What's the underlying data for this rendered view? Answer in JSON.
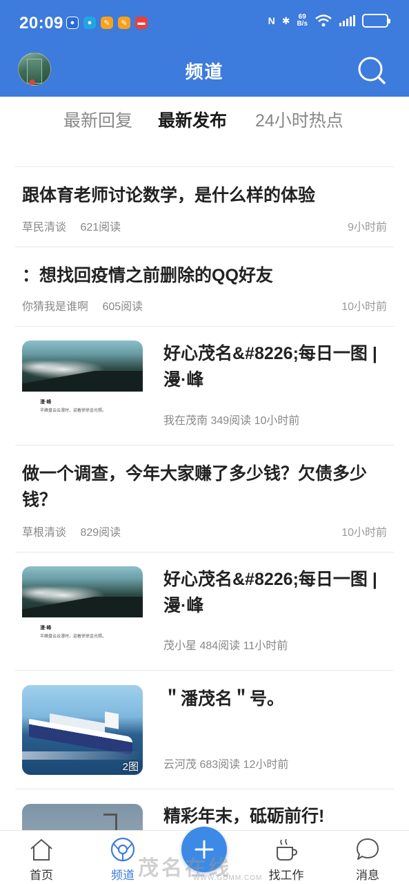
{
  "status_bar": {
    "time": "20:09",
    "network_speed_value": "69",
    "network_speed_unit": "B/s",
    "battery_level": 0.9
  },
  "header": {
    "title": "频道"
  },
  "tabs": [
    {
      "label": "最新回复",
      "active": false
    },
    {
      "label": "最新发布",
      "active": true
    },
    {
      "label": "24小时热点",
      "active": false
    }
  ],
  "feed": [
    {
      "title": "跟体育老师讨论数学，是什么样的体验",
      "author": "草民清谈",
      "reads": "621阅读",
      "time": "9小时前"
    },
    {
      "title": "：想找回疫情之前删除的QQ好友",
      "author": "你猜我是谁啊",
      "reads": "605阅读",
      "time": "10小时前"
    },
    {
      "title": "好心茂名&#8226;每日一图 | 漫·峰",
      "author": "我在茂南",
      "reads": "349阅读",
      "time": "10小时前",
      "thumb_caption_1": "漫·峰",
      "thumb_caption_2": "半峰盘云云漫时，迎着徐徐金光照。"
    },
    {
      "title": "做一个调查，今年大家赚了多少钱？欠债多少钱？",
      "author": "草根清谈",
      "reads": "829阅读",
      "time": "10小时前"
    },
    {
      "title": "好心茂名&#8226;每日一图 | 漫·峰",
      "author": "茂小星",
      "reads": "484阅读",
      "time": "11小时前",
      "thumb_caption_1": "漫·峰",
      "thumb_caption_2": "半峰盘云云漫时，迎着徐徐金光照。"
    },
    {
      "title": "＂潘茂名＂号。",
      "author": "云河茂",
      "reads": "683阅读",
      "time": "12小时前",
      "image_count": "2图"
    },
    {
      "title": "精彩年末，砥砺前行!"
    }
  ],
  "bottom_nav": [
    {
      "label": "首页",
      "icon": "home-icon"
    },
    {
      "label": "频道",
      "icon": "channel-icon",
      "active": true
    },
    {
      "label": "找工作",
      "icon": "coffee-cup-icon"
    },
    {
      "label": "消息",
      "icon": "message-bubble-icon"
    }
  ],
  "watermark": {
    "text": "茂名在线",
    "url": "WWW.GDMM.COM"
  },
  "colors": {
    "brand_blue": "#3d7bdc",
    "publish_blue": "#3d8ae6"
  }
}
